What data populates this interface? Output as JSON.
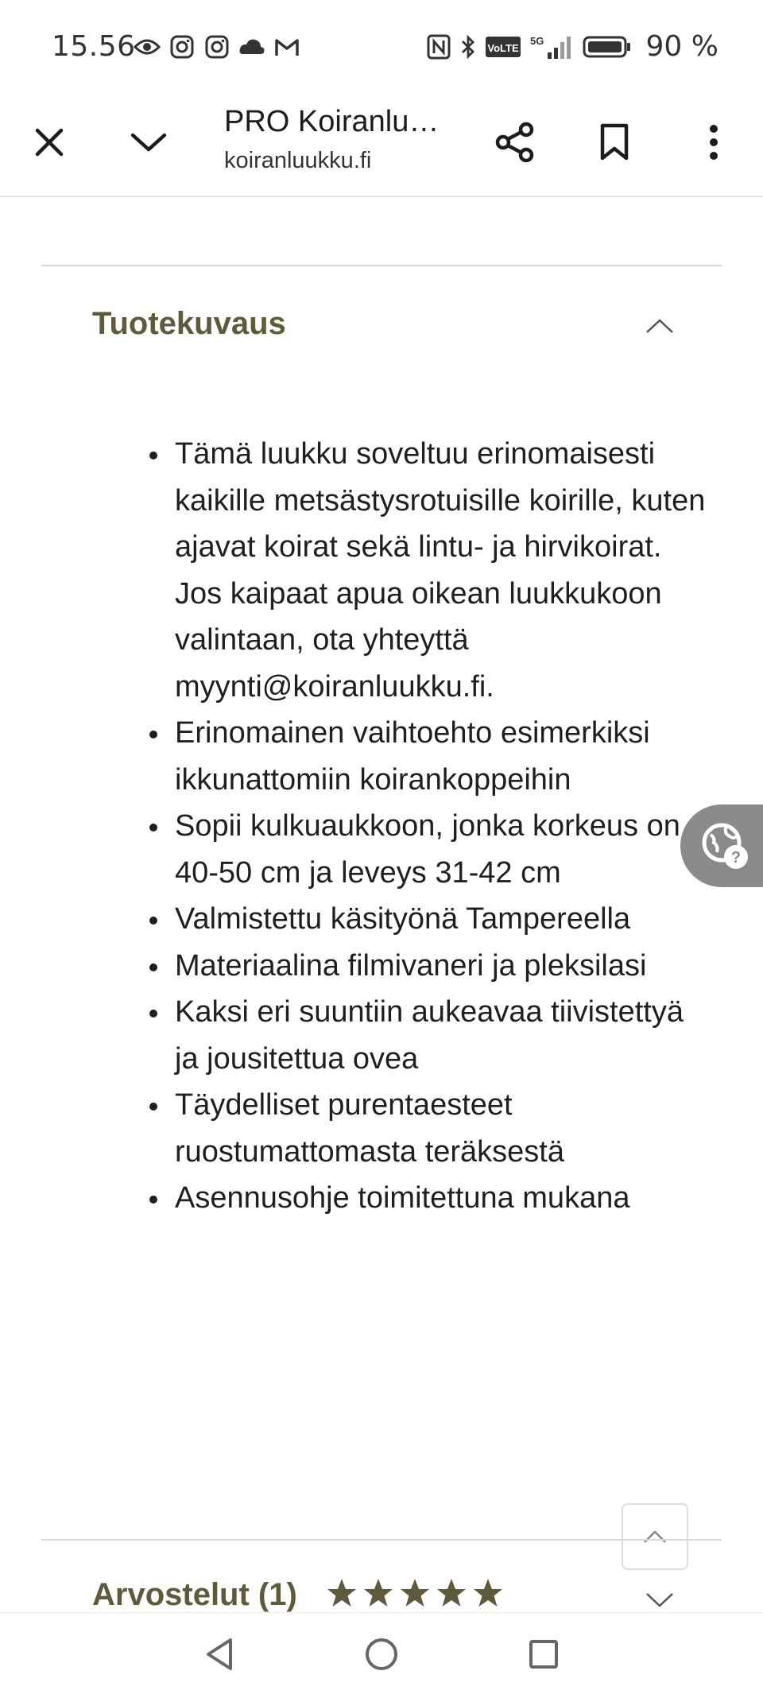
{
  "status_bar": {
    "time": "15.56",
    "battery": "90 %",
    "network": "5G",
    "volte": "VoLTE"
  },
  "browser": {
    "title": "PRO Koiranlu…",
    "domain": "koiranluukku.fi",
    "icons": [
      "close-icon",
      "chevron-down-icon",
      "share-icon",
      "bookmark-icon",
      "more-vert-icon"
    ]
  },
  "description_section": {
    "heading": "Tuotekuvaus",
    "expanded": true,
    "items": [
      "Tämä luukku soveltuu erinomaisesti kaikille metsästysrotuisille koirille, kuten ajavat koirat sekä lintu- ja hirvikoirat. Jos kaipaat apua oikean luukkukoon valintaan, ota yhteyttä myynti@koiranluukku.fi.",
      "Erinomainen vaihtoehto esimerkiksi ikkunattomiin koirankoppeihin",
      "Sopii kulkuaukkoon, jonka korkeus on 40-50 cm ja leveys 31-42 cm",
      "Valmistettu käsityönä Tampereella",
      "Materiaalina filmivaneri ja pleksilasi",
      "Kaksi eri suuntiin aukeavaa tiivistettyä ja jousitettua ovea",
      "Täydelliset purentaesteet ruostumattomasta teräksestä",
      "Asennusohje toimitettuna mukana"
    ]
  },
  "reviews_section": {
    "heading": "Arvostelut (1)",
    "rating": 5,
    "rating_max": 5,
    "expanded": false
  },
  "colors": {
    "accent": "#5f5a3a",
    "star": "#5f5a3a",
    "fab": "#8a8a8a"
  }
}
